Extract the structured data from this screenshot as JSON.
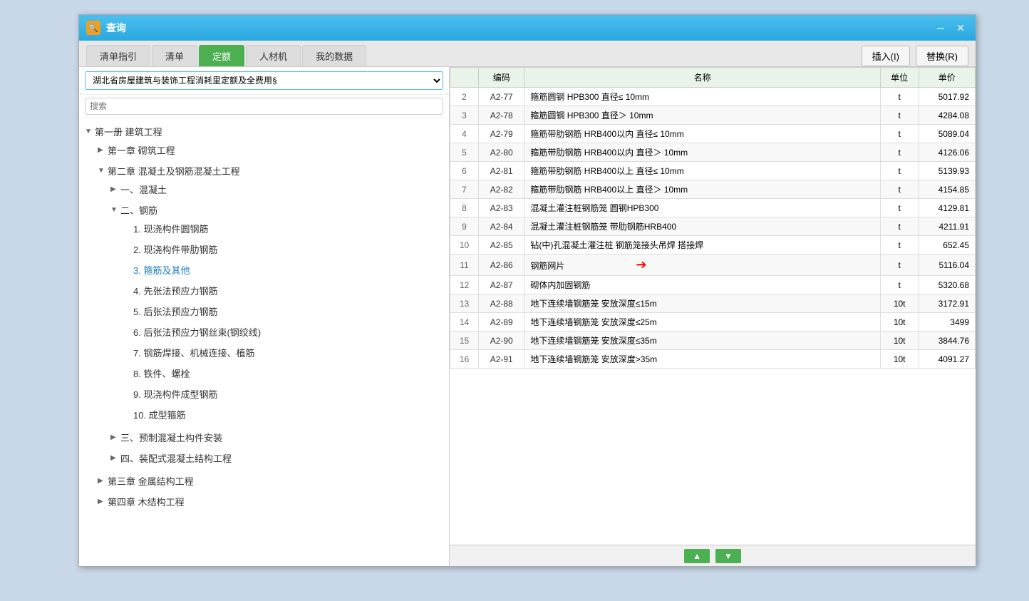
{
  "dialog": {
    "title": "查询",
    "icon_label": "查"
  },
  "tabs": [
    {
      "label": "清单指引",
      "active": false
    },
    {
      "label": "清单",
      "active": false
    },
    {
      "label": "定额",
      "active": true
    },
    {
      "label": "人材机",
      "active": false
    },
    {
      "label": "我的数据",
      "active": false
    }
  ],
  "actions": {
    "insert_label": "插入(I)",
    "replace_label": "替换(R)"
  },
  "dropdown": {
    "value": "湖北省房屋建筑与装饰工程消耗里定额及全费用§"
  },
  "search": {
    "placeholder": "搜索"
  },
  "tree": {
    "nodes": [
      {
        "label": "第一册 建筑工程",
        "expanded": true,
        "indent": 0,
        "children": [
          {
            "label": "第一章 砌筑工程",
            "expanded": false,
            "indent": 1,
            "children": []
          },
          {
            "label": "第二章 混凝土及钢筋混凝土工程",
            "expanded": true,
            "indent": 1,
            "children": [
              {
                "label": "一、混凝土",
                "expanded": false,
                "indent": 2,
                "children": []
              },
              {
                "label": "二、钢筋",
                "expanded": true,
                "indent": 2,
                "children": [
                  {
                    "label": "1. 现浇构件圆钢筋",
                    "indent": 3,
                    "leaf": true,
                    "blue": false
                  },
                  {
                    "label": "2. 现浇构件带肋钢筋",
                    "indent": 3,
                    "leaf": true,
                    "blue": false
                  },
                  {
                    "label": "3. 箍筋及其他",
                    "indent": 3,
                    "leaf": true,
                    "blue": true
                  },
                  {
                    "label": "4. 先张法预应力钢筋",
                    "indent": 3,
                    "leaf": true,
                    "blue": false
                  },
                  {
                    "label": "5. 后张法预应力钢筋",
                    "indent": 3,
                    "leaf": true,
                    "blue": false
                  },
                  {
                    "label": "6. 后张法预应力钢丝束(钢绞线)",
                    "indent": 3,
                    "leaf": true,
                    "blue": false
                  },
                  {
                    "label": "7. 钢筋焊接、机械连接、植筋",
                    "indent": 3,
                    "leaf": true,
                    "blue": false
                  },
                  {
                    "label": "8. 铁件、螺栓",
                    "indent": 3,
                    "leaf": true,
                    "blue": false
                  },
                  {
                    "label": "9. 现浇构件成型钢筋",
                    "indent": 3,
                    "leaf": true,
                    "blue": false
                  },
                  {
                    "label": "10. 成型箍筋",
                    "indent": 3,
                    "leaf": true,
                    "blue": false
                  }
                ]
              },
              {
                "label": "三、预制混凝土构件安装",
                "expanded": false,
                "indent": 2,
                "children": []
              },
              {
                "label": "四、装配式混凝土结构工程",
                "expanded": false,
                "indent": 2,
                "children": []
              }
            ]
          },
          {
            "label": "第三章 金属结构工程",
            "expanded": false,
            "indent": 1,
            "children": []
          },
          {
            "label": "第四章 木结构工程",
            "expanded": false,
            "indent": 1,
            "children": []
          }
        ]
      }
    ]
  },
  "table": {
    "headers": [
      "编码",
      "名称",
      "单位",
      "单价"
    ],
    "rows": [
      {
        "num": 2,
        "code": "A2-77",
        "name": "箍筋圆钢 HPB300 直径≤ 10mm",
        "unit": "t",
        "price": "5017.92"
      },
      {
        "num": 3,
        "code": "A2-78",
        "name": "箍筋圆钢 HPB300 直径＞ 10mm",
        "unit": "t",
        "price": "4284.08"
      },
      {
        "num": 4,
        "code": "A2-79",
        "name": "箍筋带肋钢筋 HRB400以内 直径≤ 10mm",
        "unit": "t",
        "price": "5089.04"
      },
      {
        "num": 5,
        "code": "A2-80",
        "name": "箍筋带肋钢筋 HRB400以内 直径＞ 10mm",
        "unit": "t",
        "price": "4126.06"
      },
      {
        "num": 6,
        "code": "A2-81",
        "name": "箍筋带肋钢筋 HRB400以上 直径≤ 10mm",
        "unit": "t",
        "price": "5139.93"
      },
      {
        "num": 7,
        "code": "A2-82",
        "name": "箍筋带肋钢筋 HRB400以上 直径＞ 10mm",
        "unit": "t",
        "price": "4154.85"
      },
      {
        "num": 8,
        "code": "A2-83",
        "name": "混凝土灌注桩钢筋笼 圆钢HPB300",
        "unit": "t",
        "price": "4129.81"
      },
      {
        "num": 9,
        "code": "A2-84",
        "name": "混凝土灌注桩钢筋笼 带肋钢筋HRB400",
        "unit": "t",
        "price": "4211.91"
      },
      {
        "num": 10,
        "code": "A2-85",
        "name": "钻(中)孔混凝土灌注桩 钢筋笼接头吊焊 搭接焊",
        "unit": "t",
        "price": "652.45"
      },
      {
        "num": 11,
        "code": "A2-86",
        "name": "钢筋网片",
        "unit": "t",
        "price": "5116.04",
        "arrow": true
      },
      {
        "num": 12,
        "code": "A2-87",
        "name": "砌体内加固钢筋",
        "unit": "t",
        "price": "5320.68"
      },
      {
        "num": 13,
        "code": "A2-88",
        "name": "地下连续墙钢筋笼 安放深度≤15m",
        "unit": "10t",
        "price": "3172.91"
      },
      {
        "num": 14,
        "code": "A2-89",
        "name": "地下连续墙钢筋笼 安放深度≤25m",
        "unit": "10t",
        "price": "3499"
      },
      {
        "num": 15,
        "code": "A2-90",
        "name": "地下连续墙钢筋笼 安放深度≤35m",
        "unit": "10t",
        "price": "3844.76"
      },
      {
        "num": 16,
        "code": "A2-91",
        "name": "地下连续墙钢筋笼 安放深度>35m",
        "unit": "10t",
        "price": "4091.27"
      }
    ]
  }
}
